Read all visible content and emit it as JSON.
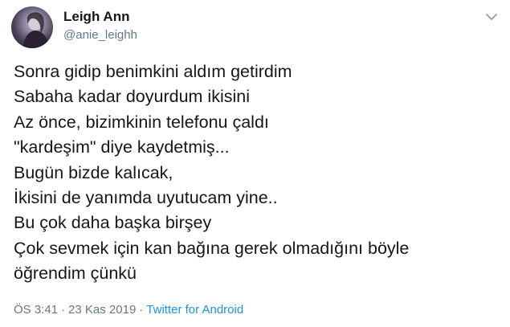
{
  "author": {
    "name": "Leigh Ann",
    "handle": "@anie_leighh",
    "avatar_icon": "profile-photo"
  },
  "more_icon": "chevron-down-icon",
  "tweet": {
    "lines": [
      "Sonra gidip benimkini aldım getirdim",
      "Sabaha kadar doyurdum ikisini",
      "Az önce, bizimkinin telefonu çaldı",
      "\"kardeşim\" diye kaydetmiş...",
      "Bugün bizde kalıcak,",
      "İkisini de yanımda uyutucam yine..",
      "Bu çok daha başka birşey",
      "Çok sevmek için kan bağına gerek olmadığını böyle",
      "öğrendim çünkü"
    ]
  },
  "meta": {
    "time": "ÖS 3:41",
    "separator": "·",
    "date": "23 Kas 2019",
    "source": "Twitter for Android"
  },
  "colors": {
    "text": "#14171a",
    "secondary": "#657786",
    "link": "#1b95e0"
  }
}
